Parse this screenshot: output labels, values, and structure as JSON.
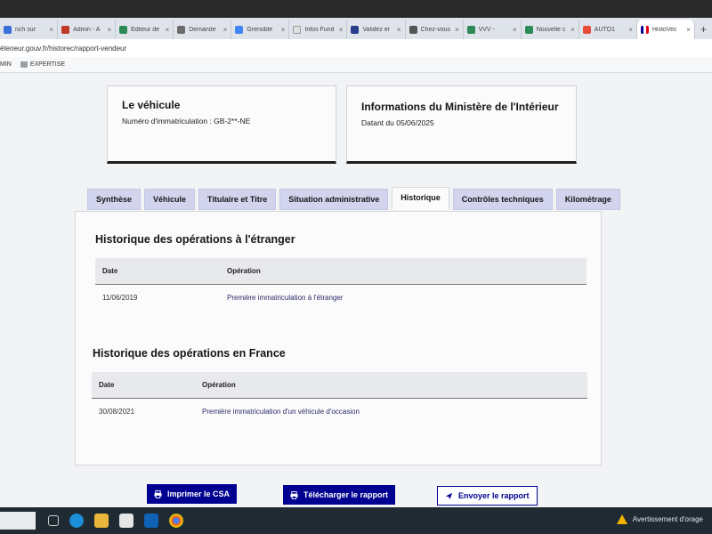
{
  "browser": {
    "tabs": [
      {
        "label": "nch sur",
        "color": "#3b6fd8"
      },
      {
        "label": "Admin - A",
        "color": "#c0392b"
      },
      {
        "label": "Editeur de",
        "color": "#2e8b57"
      },
      {
        "label": "Demande",
        "color": "#6b6b6b"
      },
      {
        "label": "Grenoble",
        "color": "#4285f4"
      },
      {
        "label": "Infos Fund",
        "color": "#e0e0e0"
      },
      {
        "label": "Validez er",
        "color": "#2b3e8c"
      },
      {
        "label": "Chez-vous",
        "color": "#555555"
      },
      {
        "label": "VVV - ",
        "color": "#2e8b57"
      },
      {
        "label": "Nouvelle c",
        "color": "#2e8b57"
      },
      {
        "label": "AUTO1",
        "color": "#e74c3c"
      },
      {
        "label": "HistoVec",
        "color": "#d33",
        "active": true
      }
    ],
    "new_tab": "+",
    "close_glyph": "×",
    "url": "éteneur.gouv.fr/historec/rapport-vendeur",
    "bookmarks": [
      "MIN",
      "EXPERTISE"
    ]
  },
  "vehicle_card": {
    "title": "Le véhicule",
    "registration": "Numéro d'immatriculation : GB-2**-NE"
  },
  "ministry_card": {
    "title": "Informations du Ministère de l'Intérieur",
    "date": "Datant du 05/06/2025"
  },
  "tabs": [
    "Synthèse",
    "Véhicule",
    "Titulaire et Titre",
    "Situation administrative",
    "Historique",
    "Contrôles techniques",
    "Kilométrage"
  ],
  "active_tab": "Historique",
  "abroad": {
    "title": "Historique des opérations à l'étranger",
    "headers": [
      "Date",
      "Opération"
    ],
    "rows": [
      {
        "date": "11/06/2019",
        "operation": "Première immatriculation à l'étranger"
      }
    ]
  },
  "france": {
    "title": "Historique des opérations en France",
    "headers": [
      "Date",
      "Opération"
    ],
    "rows": [
      {
        "date": "30/08/2021",
        "operation": "Première immatriculation d'un véhicule d'occasion"
      }
    ]
  },
  "actions": {
    "print": "Imprimer le CSA",
    "download": "Télécharger le rapport",
    "send": "Envoyer le rapport"
  },
  "taskbar": {
    "weather_alert": "Avertissement d'orage"
  },
  "colors": {
    "primary": "#000091",
    "tab_bg": "#d2d4ee",
    "warning": "#f0b400"
  }
}
